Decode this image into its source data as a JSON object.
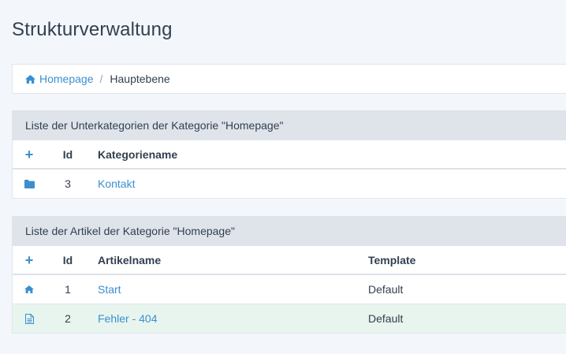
{
  "page": {
    "title": "Strukturverwaltung"
  },
  "breadcrumb": {
    "home_label": "Homepage",
    "separator": "/",
    "current": "Hauptebene"
  },
  "categories_panel": {
    "heading": "Liste der Unterkategorien der Kategorie \"Homepage\"",
    "add_symbol": "+",
    "col_id": "Id",
    "col_name": "Kategoriename",
    "rows": [
      {
        "id": "3",
        "name": "Kontakt"
      }
    ]
  },
  "articles_panel": {
    "heading": "Liste der Artikel der Kategorie \"Homepage\"",
    "add_symbol": "+",
    "col_id": "Id",
    "col_name": "Artikelname",
    "col_template": "Template",
    "rows": [
      {
        "id": "1",
        "name": "Start",
        "template": "Default"
      },
      {
        "id": "2",
        "name": "Fehler - 404",
        "template": "Default"
      }
    ]
  },
  "colors": {
    "accent": "#3b8fd0",
    "panel_header": "#dfe3ea",
    "highlight_row": "#e7f5ee"
  }
}
